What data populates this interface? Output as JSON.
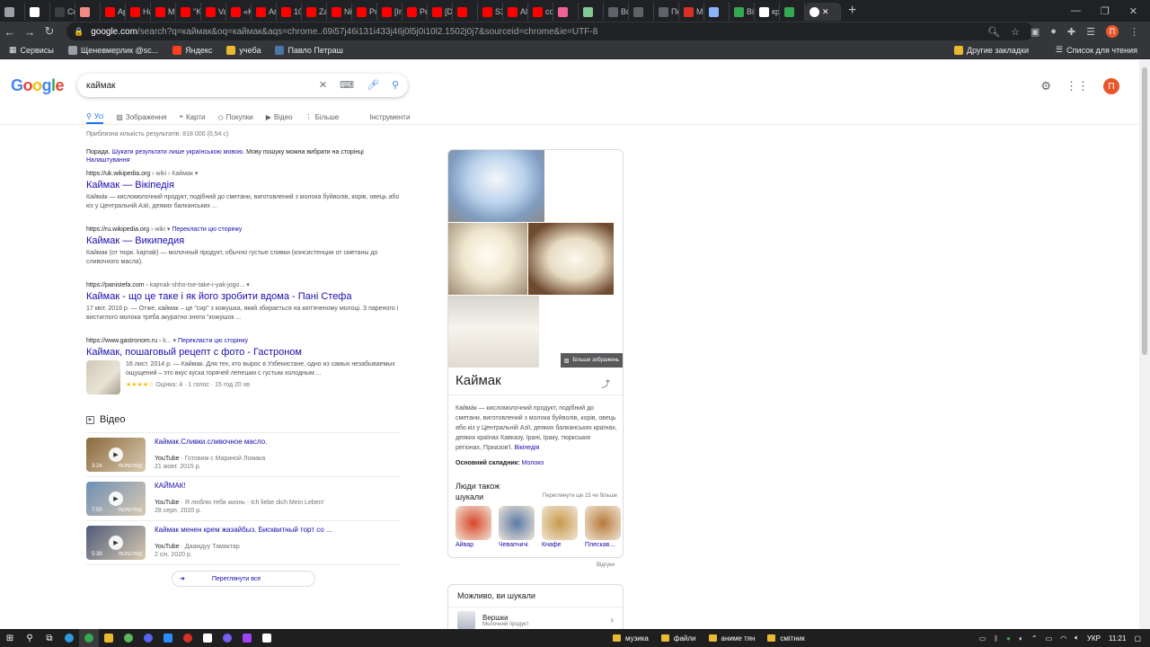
{
  "browser": {
    "tabs": [
      {
        "label": "",
        "color": "#9aa0a6"
      },
      {
        "label": "",
        "color": "#ffffff"
      },
      {
        "label": "Co",
        "color": "#3c4043"
      },
      {
        "label": "",
        "color": "#f28b82"
      },
      {
        "label": "Ap",
        "color": "#ff0000"
      },
      {
        "label": "Ha",
        "color": "#ff0000"
      },
      {
        "label": "M:",
        "color": "#ff0000"
      },
      {
        "label": "\"K",
        "color": "#ff0000"
      },
      {
        "label": "Va",
        "color": "#ff0000"
      },
      {
        "label": "«K",
        "color": "#ff0000"
      },
      {
        "label": "Ar",
        "color": "#ff0000"
      },
      {
        "label": "10",
        "color": "#ff0000"
      },
      {
        "label": "Za",
        "color": "#ff0000"
      },
      {
        "label": "Ni",
        "color": "#ff0000"
      },
      {
        "label": "Pr",
        "color": "#ff0000"
      },
      {
        "label": "[In",
        "color": "#ff0000"
      },
      {
        "label": "Pe",
        "color": "#ff0000"
      },
      {
        "label": "[D",
        "color": "#ff0000"
      },
      {
        "label": "",
        "color": "#ff0000"
      },
      {
        "label": "S3",
        "color": "#ff0000"
      },
      {
        "label": "Al!",
        "color": "#ff0000"
      },
      {
        "label": "co",
        "color": "#ff0000"
      },
      {
        "label": "",
        "color": "#f06292"
      },
      {
        "label": "",
        "color": "#81c995"
      },
      {
        "label": "Bc",
        "color": "#5f6368"
      },
      {
        "label": "",
        "color": "#5f6368"
      },
      {
        "label": "Пс",
        "color": "#5f6368"
      },
      {
        "label": "M",
        "color": "#d93025"
      },
      {
        "label": "",
        "color": "#8ab4f8"
      },
      {
        "label": "Bi",
        "color": "#34a853"
      },
      {
        "label": "кр",
        "color": "#ffffff"
      },
      {
        "label": "",
        "color": "#34a853"
      }
    ],
    "active_tab_icon": "google-icon",
    "url_host": "google.com",
    "url_rest": "/search?q=каймак&oq=каймак&aqs=chrome..69i57j46i131i433j46j0l5j0i10l2.1502j0j7&sourceid=chrome&ie=UTF-8",
    "profile_letter": "П",
    "bookmarks": [
      {
        "label": "Сервисы",
        "color": "#e8eaed"
      },
      {
        "label": "Щеневмерлик @sc...",
        "color": "#9aa0a6"
      },
      {
        "label": "Яндекс",
        "color": "#fc3f1d"
      },
      {
        "label": "учеба",
        "color": "#e8b931"
      },
      {
        "label": "Павло Петраш",
        "color": "#4a76a8"
      }
    ],
    "bookmarks_right": [
      "Другие закладки",
      "Список для чтения"
    ]
  },
  "google": {
    "logo": "Google",
    "query": "каймак",
    "avatar": "П",
    "tabs": [
      "Усі",
      "Зображення",
      "Карти",
      "Покупки",
      "Відео",
      "Більше"
    ],
    "tools": "Інструменти"
  },
  "results": {
    "stats": "Приблизна кількість результатів: 818 000 (0,54 с)",
    "tip_prefix": "Порада. ",
    "tip_link": "Шукати результати лише українською мовою",
    "tip_suffix": ". Мову пошуку можна вибрати на сторінці ",
    "tip_link2": "Налаштування",
    "items": [
      {
        "host": "https://uk.wikipedia.org",
        "crumb": " › wiki › Каймак",
        "translate": "",
        "title": "Каймак — Вікіпедія",
        "snippet": "Кайма́к — кисломолочний продукт, подібний до сметани, виготовлений з молока буйволів, корів, овець або кіз у Центральній Азії, деяких балканських ..."
      },
      {
        "host": "https://ru.wikipedia.org",
        "crumb": " › wiki",
        "translate": "Перекласти цю сторінку",
        "title": "Каймак — Википедия",
        "snippet": "Каймак (от тюрк. kajmak) — молочный продукт, обычно густые сливки (консистенции от сметаны до сливочного масла)."
      },
      {
        "host": "https://panistefa.com",
        "crumb": " › kajmak-shho-tse-take-i-yak-jogo...",
        "translate": "",
        "title": "Каймак - що це таке і як його зробити вдома - Пані Стефа",
        "snippet": "17 квіт. 2016 р. — Отже, каймак – це \"сир\" з кожушка, який збирається на кип'яченому молоці. З пареного і вистиглого молока треба акуратно зняти \"кожушок ..."
      }
    ],
    "gastronom": {
      "host": "https://www.gastronom.ru",
      "crumb": " › k...",
      "translate": "Перекласти цю сторінку",
      "title": "Каймак, пошаговый рецепт с фото - Гастроном",
      "snippet": "16 лист. 2014 р. — Каймак. Для тех, кто вырос в Узбекистане, одно из самых незабываемых ощущений – это вкус куска горячей лепешки с густым холодным ...",
      "stars": "★★★★☆",
      "rating_text": "Оцінка: 4 · 1 голос · 15 год 20 хв"
    },
    "video_heading": "Відео",
    "videos": [
      {
        "title": "Каймак.Сливки.сливочное масло.",
        "source": "YouTube",
        "channel": " · Готовим с Мариной Ломака",
        "date": "21 жовт. 2015 р.",
        "duration": "3:24",
        "preview": "ПЕРЕГЛЯД",
        "bg": "#8a6a3c"
      },
      {
        "title": "КАЙМАК!",
        "source": "YouTube",
        "channel": " · Я люблю тебя жизнь - Ich liebe dich Mein Leben!",
        "date": "28 серп. 2020 р.",
        "duration": "7:55",
        "preview": "ПЕРЕГЛЯД",
        "bg": "#6e8fb6"
      },
      {
        "title": "Каймак менен крем жазайбыз. Бисквитный торт со ...",
        "source": "YouTube",
        "channel": " · Даамдуу Тамактар",
        "date": "2 січ. 2020 р.",
        "duration": "5:38",
        "preview": "ПЕРЕГЛЯД",
        "bg": "#4e5b7a"
      }
    ],
    "view_all": "Переглянути все"
  },
  "knowledge_panel": {
    "more_images": "Більше зображень",
    "title": "Каймак",
    "description": "Кайма́к — кисломолочний продукт, подібний до сметани, виготовлений з молока буйволів, корів, овець або кіз у Центральній Азії, деяких балканських країнах, деяких країнах Кавказу, Ірані, Іраку, тюркських регіонах, Приазов'ї.",
    "desc_link": "Вікіпедія",
    "ingredient_label": "Основний складник:",
    "ingredient_value": "Молоко",
    "people_head": "Люди також шукали",
    "people_more": "Переглянути ще 15 чи більше",
    "people": [
      {
        "label": "Айвар",
        "color": "#d9472b"
      },
      {
        "label": "Чевапчичі",
        "color": "#5b7aa8"
      },
      {
        "label": "Кнафе",
        "color": "#c79a4a"
      },
      {
        "label": "Плескав...",
        "color": "#b77a3a"
      }
    ],
    "feedback": "Відгуки"
  },
  "also_search": {
    "title": "Можливо, ви шукали",
    "name": "Вершки",
    "sub": "Молочний продукт"
  },
  "taskbar": {
    "folders": [
      "музика",
      "файли",
      "аниме тян",
      "смітник"
    ],
    "lang": "УКР",
    "time": "11:21"
  }
}
